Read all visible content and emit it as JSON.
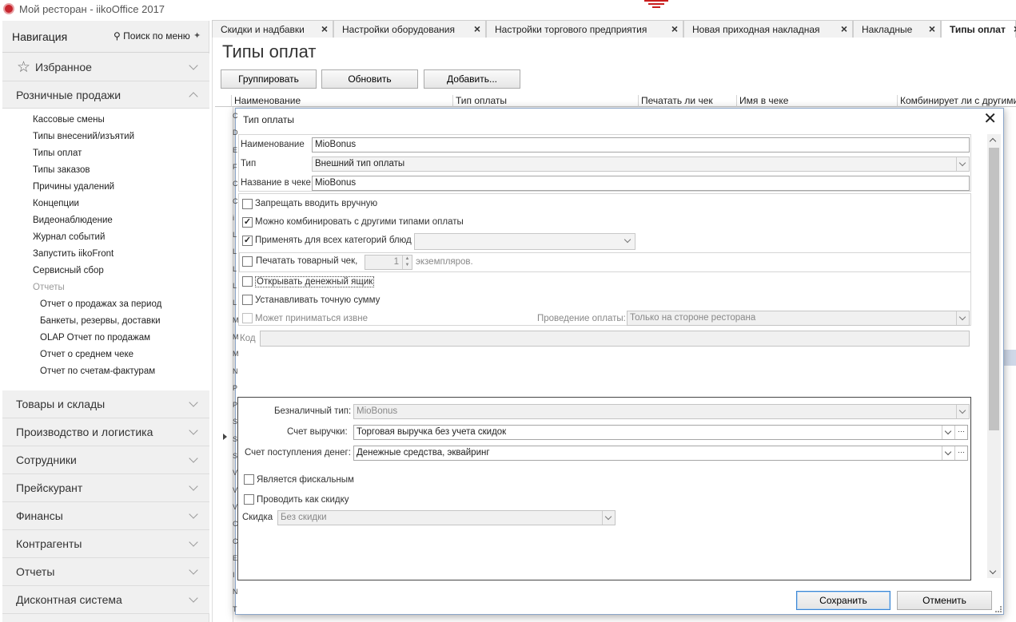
{
  "window": {
    "title": "Мой ресторан - iikoOffice 2017"
  },
  "nav": {
    "title": "Навигация",
    "search_label": "Поиск по меню",
    "favorites": "Избранное",
    "retail": "Розничные продажи",
    "items": [
      "Кассовые смены",
      "Типы внесений/изъятий",
      "Типы оплат",
      "Типы заказов",
      "Причины удалений",
      "Концепции",
      "Видеонаблюдение",
      "Журнал событий",
      "Запустить iikoFront",
      "Сервисный сбор"
    ],
    "reports_label": "Отчеты",
    "sub_items": [
      "Отчет о продажах за период",
      "Банкеты, резервы, доставки",
      "OLAP Отчет по продажам",
      "Отчет о среднем чеке",
      "Отчет по счетам-фактурам"
    ],
    "sections": [
      "Товары и склады",
      "Производство и логистика",
      "Сотрудники",
      "Прейскурант",
      "Финансы",
      "Контрагенты",
      "Отчеты",
      "Дисконтная система"
    ]
  },
  "tabs": [
    {
      "label": "Скидки и надбавки"
    },
    {
      "label": "Настройки оборудования"
    },
    {
      "label": "Настройки торгового предприятия"
    },
    {
      "label": "Новая приходная накладная"
    },
    {
      "label": "Накладные"
    },
    {
      "label": "Типы оплат"
    }
  ],
  "page": {
    "title": "Типы оплат",
    "toolbar": {
      "group": "Группировать",
      "refresh": "Обновить",
      "add": "Добавить..."
    },
    "columns": [
      "Наименование",
      "Тип оплаты",
      "Печатать ли чек",
      "Имя в чеке",
      "Комбинирует ли с другими"
    ],
    "row_letters": [
      "C",
      "D",
      "E",
      "F",
      "C",
      "C",
      "i",
      "L",
      "L",
      "L",
      "L",
      "L",
      "M",
      "M",
      "M",
      "N",
      "P",
      "P",
      "S",
      "S",
      "S",
      "V",
      "V",
      "V",
      "C",
      "C",
      "E",
      "I",
      "N",
      "T"
    ]
  },
  "dialog": {
    "title": "Тип оплаты",
    "name_label": "Наименование",
    "name_value": "MioBonus",
    "type_label": "Тип",
    "type_value": "Внешний тип оплаты",
    "check_name_label": "Название в чеке",
    "check_name_value": "MioBonus",
    "forbid_manual": "Запрещать вводить вручную",
    "combine": "Можно комбинировать с другими типами оплаты",
    "apply_all": "Применять для всех категорий блюд",
    "print_receipt": "Печатать товарный чек,",
    "copies_value": "1",
    "copies_label": "экземпляров.",
    "open_drawer": "Открывать денежный ящик",
    "exact_sum": "Устанавливать точную сумму",
    "accept_external": "Может приниматься извне",
    "processing_label": "Проведение оплаты:",
    "processing_value": "Только на стороне ресторана",
    "code_label": "Код",
    "cashless_label": "Безналичный тип:",
    "cashless_value": "MioBonus",
    "revenue_label": "Счет выручки:",
    "revenue_value": "Торговая выручка без учета скидок",
    "income_label": "Счет поступления денег:",
    "income_value": "Денежные средства, эквайринг",
    "fiscal": "Является фискальным",
    "as_discount": "Проводить как скидку",
    "discount_label": "Скидка",
    "discount_value": "Без скидки",
    "save": "Сохранить",
    "cancel": "Отменить",
    "checked": {
      "combine": true,
      "apply_all": true
    }
  }
}
